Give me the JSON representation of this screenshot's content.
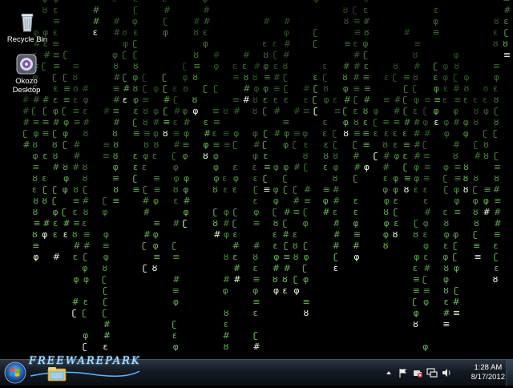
{
  "desktop": {
    "icons": [
      {
        "label": "Recycle Bin",
        "icon": "recycle-bin-icon"
      },
      {
        "label": "Okozo\nDesktop",
        "icon": "okozo-desktop-icon"
      }
    ],
    "matrix_glyphs": [
      "φ",
      "ʗ",
      "≡",
      "ȣ",
      "#",
      "ɛ"
    ],
    "matrix_color": "#7fd36b"
  },
  "taskbar": {
    "start_icon": "windows-start-icon",
    "brand_text": "FREEWAREPARK",
    "pinned": [
      {
        "icon": "windows-explorer-icon"
      }
    ],
    "tray_icons": [
      "show-hidden-icons-arrow",
      "action-center-flag-icon",
      "power-icon",
      "network-icon",
      "volume-icon"
    ],
    "clock": {
      "time": "1:28 AM",
      "date": "8/17/2012"
    }
  }
}
